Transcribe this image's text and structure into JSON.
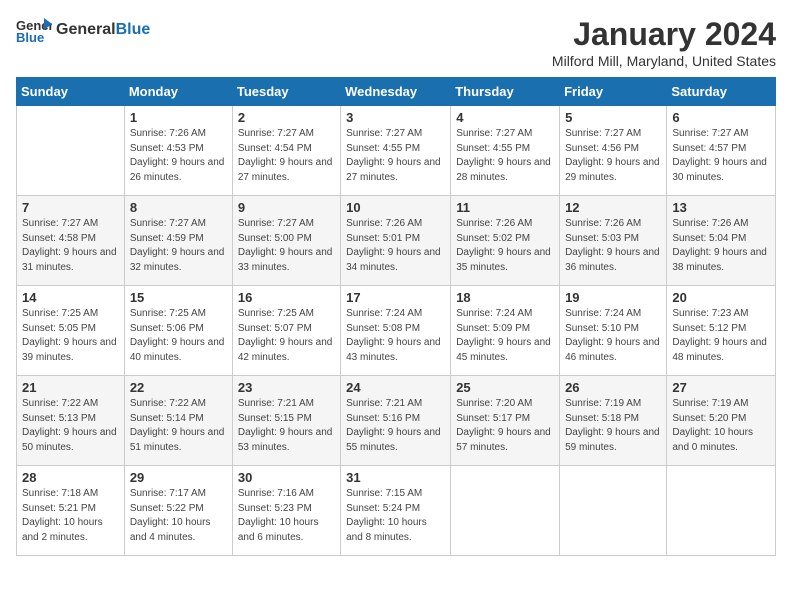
{
  "header": {
    "logo_general": "General",
    "logo_blue": "Blue",
    "title": "January 2024",
    "subtitle": "Milford Mill, Maryland, United States"
  },
  "columns": [
    "Sunday",
    "Monday",
    "Tuesday",
    "Wednesday",
    "Thursday",
    "Friday",
    "Saturday"
  ],
  "weeks": [
    [
      {
        "day": "",
        "sunrise": "",
        "sunset": "",
        "daylight": ""
      },
      {
        "day": "1",
        "sunrise": "7:26 AM",
        "sunset": "4:53 PM",
        "daylight": "9 hours and 26 minutes."
      },
      {
        "day": "2",
        "sunrise": "7:27 AM",
        "sunset": "4:54 PM",
        "daylight": "9 hours and 27 minutes."
      },
      {
        "day": "3",
        "sunrise": "7:27 AM",
        "sunset": "4:55 PM",
        "daylight": "9 hours and 27 minutes."
      },
      {
        "day": "4",
        "sunrise": "7:27 AM",
        "sunset": "4:55 PM",
        "daylight": "9 hours and 28 minutes."
      },
      {
        "day": "5",
        "sunrise": "7:27 AM",
        "sunset": "4:56 PM",
        "daylight": "9 hours and 29 minutes."
      },
      {
        "day": "6",
        "sunrise": "7:27 AM",
        "sunset": "4:57 PM",
        "daylight": "9 hours and 30 minutes."
      }
    ],
    [
      {
        "day": "7",
        "sunrise": "7:27 AM",
        "sunset": "4:58 PM",
        "daylight": "9 hours and 31 minutes."
      },
      {
        "day": "8",
        "sunrise": "7:27 AM",
        "sunset": "4:59 PM",
        "daylight": "9 hours and 32 minutes."
      },
      {
        "day": "9",
        "sunrise": "7:27 AM",
        "sunset": "5:00 PM",
        "daylight": "9 hours and 33 minutes."
      },
      {
        "day": "10",
        "sunrise": "7:26 AM",
        "sunset": "5:01 PM",
        "daylight": "9 hours and 34 minutes."
      },
      {
        "day": "11",
        "sunrise": "7:26 AM",
        "sunset": "5:02 PM",
        "daylight": "9 hours and 35 minutes."
      },
      {
        "day": "12",
        "sunrise": "7:26 AM",
        "sunset": "5:03 PM",
        "daylight": "9 hours and 36 minutes."
      },
      {
        "day": "13",
        "sunrise": "7:26 AM",
        "sunset": "5:04 PM",
        "daylight": "9 hours and 38 minutes."
      }
    ],
    [
      {
        "day": "14",
        "sunrise": "7:25 AM",
        "sunset": "5:05 PM",
        "daylight": "9 hours and 39 minutes."
      },
      {
        "day": "15",
        "sunrise": "7:25 AM",
        "sunset": "5:06 PM",
        "daylight": "9 hours and 40 minutes."
      },
      {
        "day": "16",
        "sunrise": "7:25 AM",
        "sunset": "5:07 PM",
        "daylight": "9 hours and 42 minutes."
      },
      {
        "day": "17",
        "sunrise": "7:24 AM",
        "sunset": "5:08 PM",
        "daylight": "9 hours and 43 minutes."
      },
      {
        "day": "18",
        "sunrise": "7:24 AM",
        "sunset": "5:09 PM",
        "daylight": "9 hours and 45 minutes."
      },
      {
        "day": "19",
        "sunrise": "7:24 AM",
        "sunset": "5:10 PM",
        "daylight": "9 hours and 46 minutes."
      },
      {
        "day": "20",
        "sunrise": "7:23 AM",
        "sunset": "5:12 PM",
        "daylight": "9 hours and 48 minutes."
      }
    ],
    [
      {
        "day": "21",
        "sunrise": "7:22 AM",
        "sunset": "5:13 PM",
        "daylight": "9 hours and 50 minutes."
      },
      {
        "day": "22",
        "sunrise": "7:22 AM",
        "sunset": "5:14 PM",
        "daylight": "9 hours and 51 minutes."
      },
      {
        "day": "23",
        "sunrise": "7:21 AM",
        "sunset": "5:15 PM",
        "daylight": "9 hours and 53 minutes."
      },
      {
        "day": "24",
        "sunrise": "7:21 AM",
        "sunset": "5:16 PM",
        "daylight": "9 hours and 55 minutes."
      },
      {
        "day": "25",
        "sunrise": "7:20 AM",
        "sunset": "5:17 PM",
        "daylight": "9 hours and 57 minutes."
      },
      {
        "day": "26",
        "sunrise": "7:19 AM",
        "sunset": "5:18 PM",
        "daylight": "9 hours and 59 minutes."
      },
      {
        "day": "27",
        "sunrise": "7:19 AM",
        "sunset": "5:20 PM",
        "daylight": "10 hours and 0 minutes."
      }
    ],
    [
      {
        "day": "28",
        "sunrise": "7:18 AM",
        "sunset": "5:21 PM",
        "daylight": "10 hours and 2 minutes."
      },
      {
        "day": "29",
        "sunrise": "7:17 AM",
        "sunset": "5:22 PM",
        "daylight": "10 hours and 4 minutes."
      },
      {
        "day": "30",
        "sunrise": "7:16 AM",
        "sunset": "5:23 PM",
        "daylight": "10 hours and 6 minutes."
      },
      {
        "day": "31",
        "sunrise": "7:15 AM",
        "sunset": "5:24 PM",
        "daylight": "10 hours and 8 minutes."
      },
      {
        "day": "",
        "sunrise": "",
        "sunset": "",
        "daylight": ""
      },
      {
        "day": "",
        "sunrise": "",
        "sunset": "",
        "daylight": ""
      },
      {
        "day": "",
        "sunrise": "",
        "sunset": "",
        "daylight": ""
      }
    ]
  ],
  "labels": {
    "sunrise_prefix": "Sunrise: ",
    "sunset_prefix": "Sunset: ",
    "daylight_prefix": "Daylight: "
  }
}
